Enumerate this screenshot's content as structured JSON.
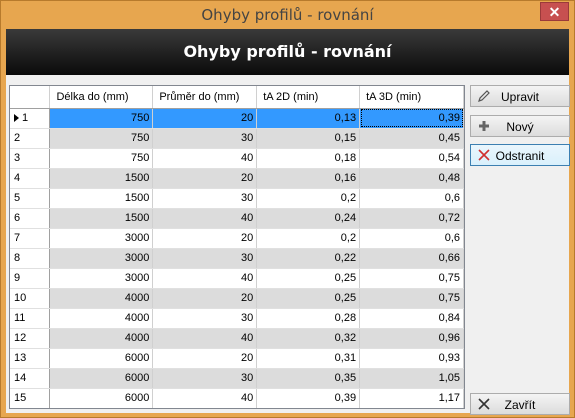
{
  "window": {
    "title": "Ohyby profilů - rovnání",
    "close_symbol": "✕"
  },
  "header": {
    "title": "Ohyby profilů - rovnání"
  },
  "grid": {
    "columns": [
      "Délka do (mm)",
      "Průměr do (mm)",
      "tA 2D (min)",
      "tA 3D (min)"
    ],
    "rows": [
      {
        "n": "1",
        "delka": "750",
        "prumer": "20",
        "t2d": "0,13",
        "t3d": "0,39"
      },
      {
        "n": "2",
        "delka": "750",
        "prumer": "30",
        "t2d": "0,15",
        "t3d": "0,45"
      },
      {
        "n": "3",
        "delka": "750",
        "prumer": "40",
        "t2d": "0,18",
        "t3d": "0,54"
      },
      {
        "n": "4",
        "delka": "1500",
        "prumer": "20",
        "t2d": "0,16",
        "t3d": "0,48"
      },
      {
        "n": "5",
        "delka": "1500",
        "prumer": "30",
        "t2d": "0,2",
        "t3d": "0,6"
      },
      {
        "n": "6",
        "delka": "1500",
        "prumer": "40",
        "t2d": "0,24",
        "t3d": "0,72"
      },
      {
        "n": "7",
        "delka": "3000",
        "prumer": "20",
        "t2d": "0,2",
        "t3d": "0,6"
      },
      {
        "n": "8",
        "delka": "3000",
        "prumer": "30",
        "t2d": "0,22",
        "t3d": "0,66"
      },
      {
        "n": "9",
        "delka": "3000",
        "prumer": "40",
        "t2d": "0,25",
        "t3d": "0,75"
      },
      {
        "n": "10",
        "delka": "4000",
        "prumer": "20",
        "t2d": "0,25",
        "t3d": "0,75"
      },
      {
        "n": "11",
        "delka": "4000",
        "prumer": "30",
        "t2d": "0,28",
        "t3d": "0,84"
      },
      {
        "n": "12",
        "delka": "4000",
        "prumer": "40",
        "t2d": "0,32",
        "t3d": "0,96"
      },
      {
        "n": "13",
        "delka": "6000",
        "prumer": "20",
        "t2d": "0,31",
        "t3d": "0,93"
      },
      {
        "n": "14",
        "delka": "6000",
        "prumer": "30",
        "t2d": "0,35",
        "t3d": "1,05"
      },
      {
        "n": "15",
        "delka": "6000",
        "prumer": "40",
        "t2d": "0,39",
        "t3d": "1,17"
      }
    ]
  },
  "buttons": {
    "edit": {
      "label": "Upravit",
      "icon": "pencil-icon"
    },
    "new": {
      "label": "Nový",
      "icon": "plus-icon"
    },
    "delete": {
      "label": "Odstranit",
      "icon": "red-x-icon"
    },
    "close": {
      "label": "Zavřít",
      "icon": "x-icon"
    }
  },
  "colors": {
    "selection": "#3399ff",
    "alt_row": "#dcdcdc",
    "frame": "#e7a64f",
    "delete_icon": "#d03030"
  }
}
